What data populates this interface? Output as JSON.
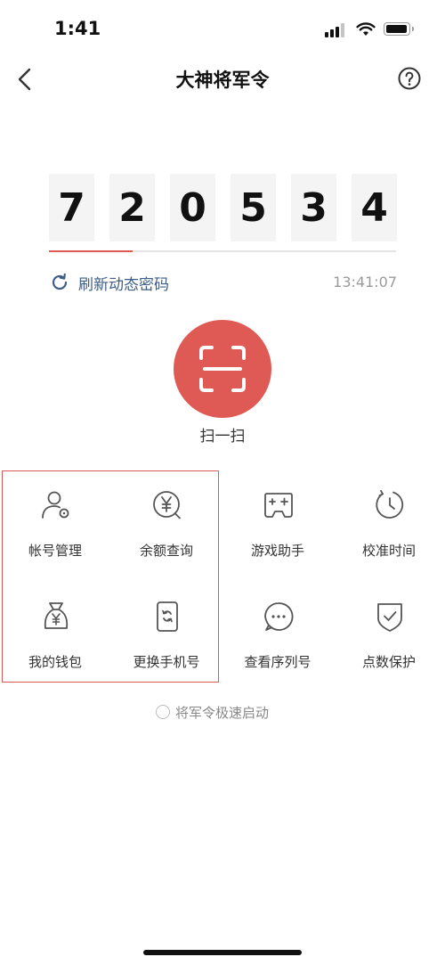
{
  "status_bar": {
    "time": "1:41"
  },
  "nav": {
    "title": "大神将军令"
  },
  "code": {
    "digits": [
      "7",
      "2",
      "0",
      "5",
      "3",
      "4"
    ],
    "progress": 0.24
  },
  "refresh": {
    "label": "刷新动态密码",
    "time": "13:41:07"
  },
  "scan": {
    "label": "扫一扫"
  },
  "grid": {
    "account": "帐号管理",
    "balance": "余额查询",
    "game_assistant": "游戏助手",
    "calibrate_time": "校准时间",
    "wallet": "我的钱包",
    "change_phone": "更换手机号",
    "serial_number": "查看序列号",
    "point_protect": "点数保护"
  },
  "quick_start": {
    "label": "将军令极速启动"
  },
  "colors": {
    "accent": "#e05a55",
    "link": "#3d5e86",
    "icon": "#555555"
  }
}
